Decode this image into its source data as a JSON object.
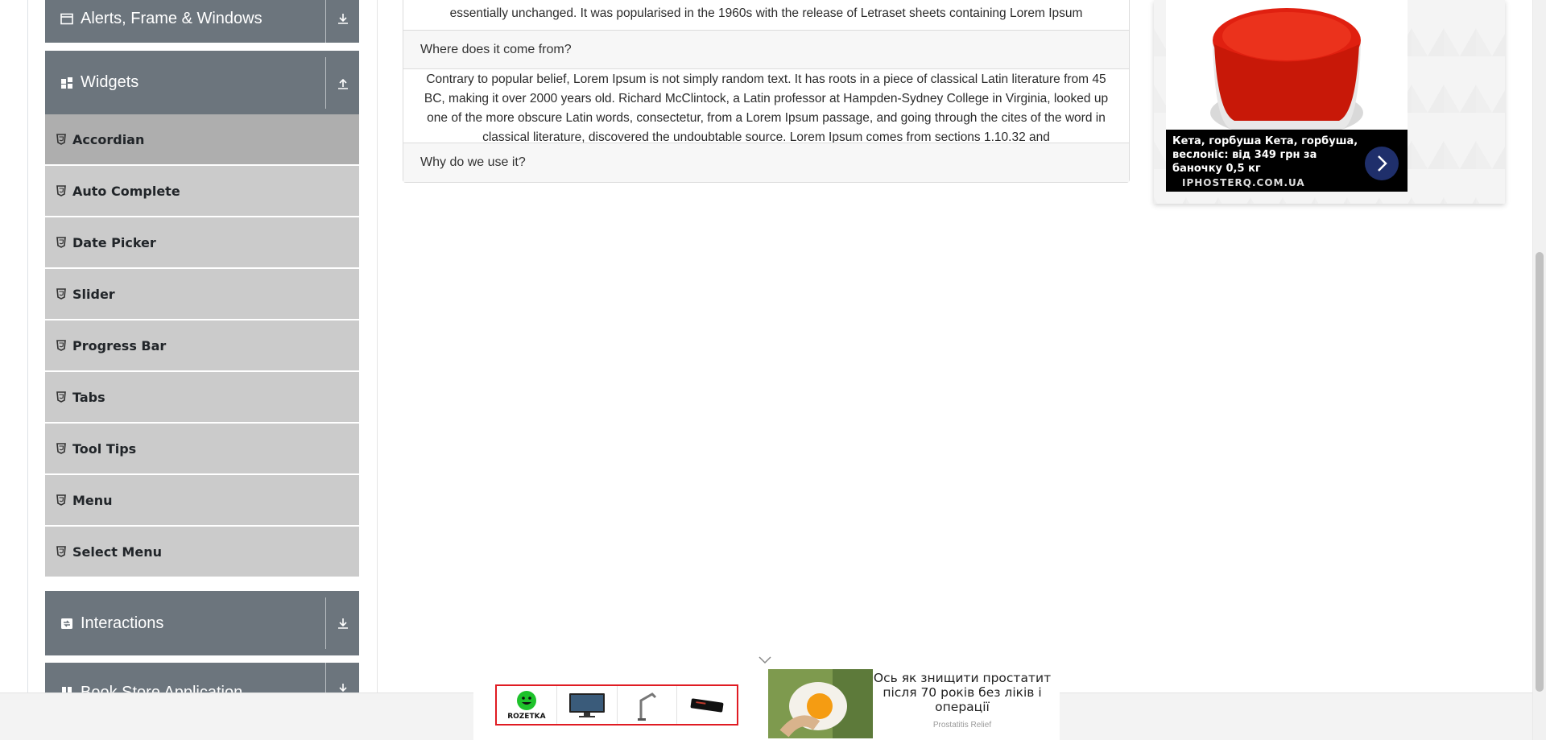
{
  "sidebar": {
    "groups": [
      {
        "label": "Alerts, Frame & Windows",
        "icon": "window-icon",
        "toggle_icon": "download-arrow-icon"
      },
      {
        "label": "Widgets",
        "icon": "widgets-grid-icon",
        "toggle_icon": "upload-arrow-icon"
      },
      {
        "label": "Interactions",
        "icon": "interactions-icon",
        "toggle_icon": "download-arrow-icon"
      },
      {
        "label": "Book Store Application",
        "icon": "book-icon",
        "toggle_icon": "download-arrow-icon"
      }
    ],
    "widget_items": [
      {
        "label": "Accordian",
        "active": true
      },
      {
        "label": "Auto Complete"
      },
      {
        "label": "Date Picker"
      },
      {
        "label": "Slider"
      },
      {
        "label": "Progress Bar"
      },
      {
        "label": "Tabs"
      },
      {
        "label": "Tool Tips"
      },
      {
        "label": "Menu"
      },
      {
        "label": "Select Menu"
      }
    ]
  },
  "accordion": {
    "section1_text_line1": "essentially unchanged. It was popularised in the 1960s with the release of Letraset sheets containing Lorem Ipsum",
    "section2_header": "Where does it come from?",
    "section2_text": "Contrary to popular belief, Lorem Ipsum is not simply random text. It has roots in a piece of classical Latin literature from 45 BC, making it over 2000 years old. Richard McClintock, a Latin professor at Hampden-Sydney College in Virginia, looked up one of the more obscure Latin words, consectetur, from a Lorem Ipsum passage, and going through the cites of the word in classical literature, discovered the undoubtable source. Lorem Ipsum comes from sections 1.10.32 and",
    "section3_header": "Why do we use it?"
  },
  "ad_right": {
    "caption": "Кета, горбуша Кета, горбуша, веслоніс: від 349 грн за баночку 0,5 кг",
    "domain": "IPHOSTERQ.COM.UA"
  },
  "bottom_ad": {
    "rozetka_label": "ROZETKA",
    "title": "Ось як знищити простатит після 70 років без ліків і операції",
    "source": "Prostatitis Relief"
  },
  "colors": {
    "group_header_bg": "#6c757d",
    "item_bg": "#cbcbcb",
    "item_active_bg": "#aeaeae",
    "accent_red": "#e01b22",
    "ad_arrow_bg": "#1f2f6b"
  }
}
